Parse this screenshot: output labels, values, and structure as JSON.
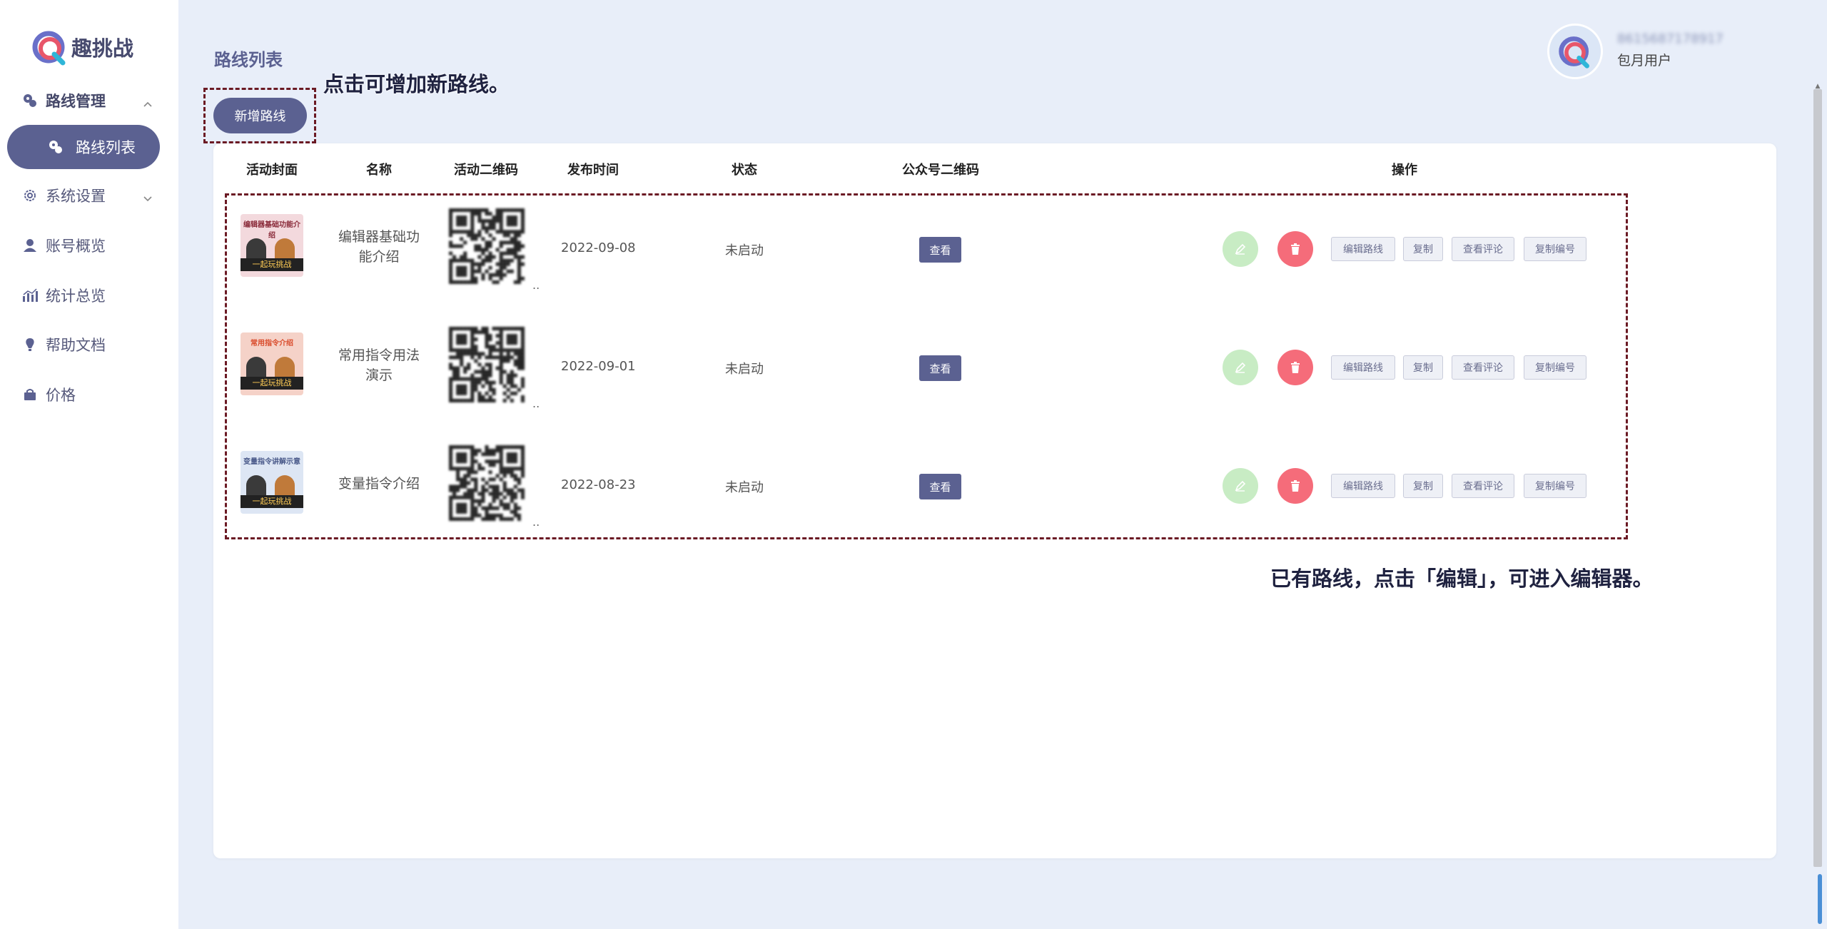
{
  "brand": {
    "name": "趣挑战"
  },
  "sidebar": {
    "items": [
      {
        "label": "路线管理",
        "icon": "route-icon"
      },
      {
        "label": "路线列表",
        "icon": "route-list-icon"
      },
      {
        "label": "系统设置",
        "icon": "gear-icon"
      },
      {
        "label": "账号概览",
        "icon": "user-icon"
      },
      {
        "label": "统计总览",
        "icon": "bar-chart-icon"
      },
      {
        "label": "帮助文档",
        "icon": "help-icon"
      },
      {
        "label": "价格",
        "icon": "bag-icon"
      }
    ]
  },
  "header": {
    "title": "路线列表",
    "add_button": "新增路线",
    "user_role": "包月用户",
    "user_name": "8615687178917"
  },
  "annotations": {
    "add_hint": "点击可增加新路线。",
    "edit_hint": "已有路线，点击「编辑」，可进入编辑器。"
  },
  "table": {
    "headers": [
      "活动封面",
      "名称",
      "活动二维码",
      "发布时间",
      "状态",
      "公众号二维码",
      "操作"
    ],
    "rows": [
      {
        "name": "编辑器基础功能介绍",
        "date": "2022-09-08",
        "status": "未启动",
        "cover_title": "编辑器基础功能介绍",
        "cover_band": "一起玩挑战",
        "cover_color": "#f3d9dd",
        "ellipsis": ".."
      },
      {
        "name": "常用指令用法演示",
        "date": "2022-09-01",
        "status": "未启动",
        "cover_title": "常用指令介绍",
        "cover_band": "一起玩挑战",
        "cover_color": "#f5d2c8",
        "ellipsis": ".."
      },
      {
        "name": "变量指令介绍",
        "date": "2022-08-23",
        "status": "未启动",
        "cover_title": "变量指令讲解示意",
        "cover_band": "一起玩挑战",
        "cover_color": "#dde6f4",
        "ellipsis": ".."
      }
    ],
    "view_label": "查看",
    "actions": [
      "编辑路线",
      "复制",
      "查看评论",
      "复制编号"
    ]
  },
  "colors": {
    "accent": "#5b6191",
    "danger": "#f56c7a",
    "success_light": "#c8ecc4",
    "callout_border": "#6b1a24"
  }
}
